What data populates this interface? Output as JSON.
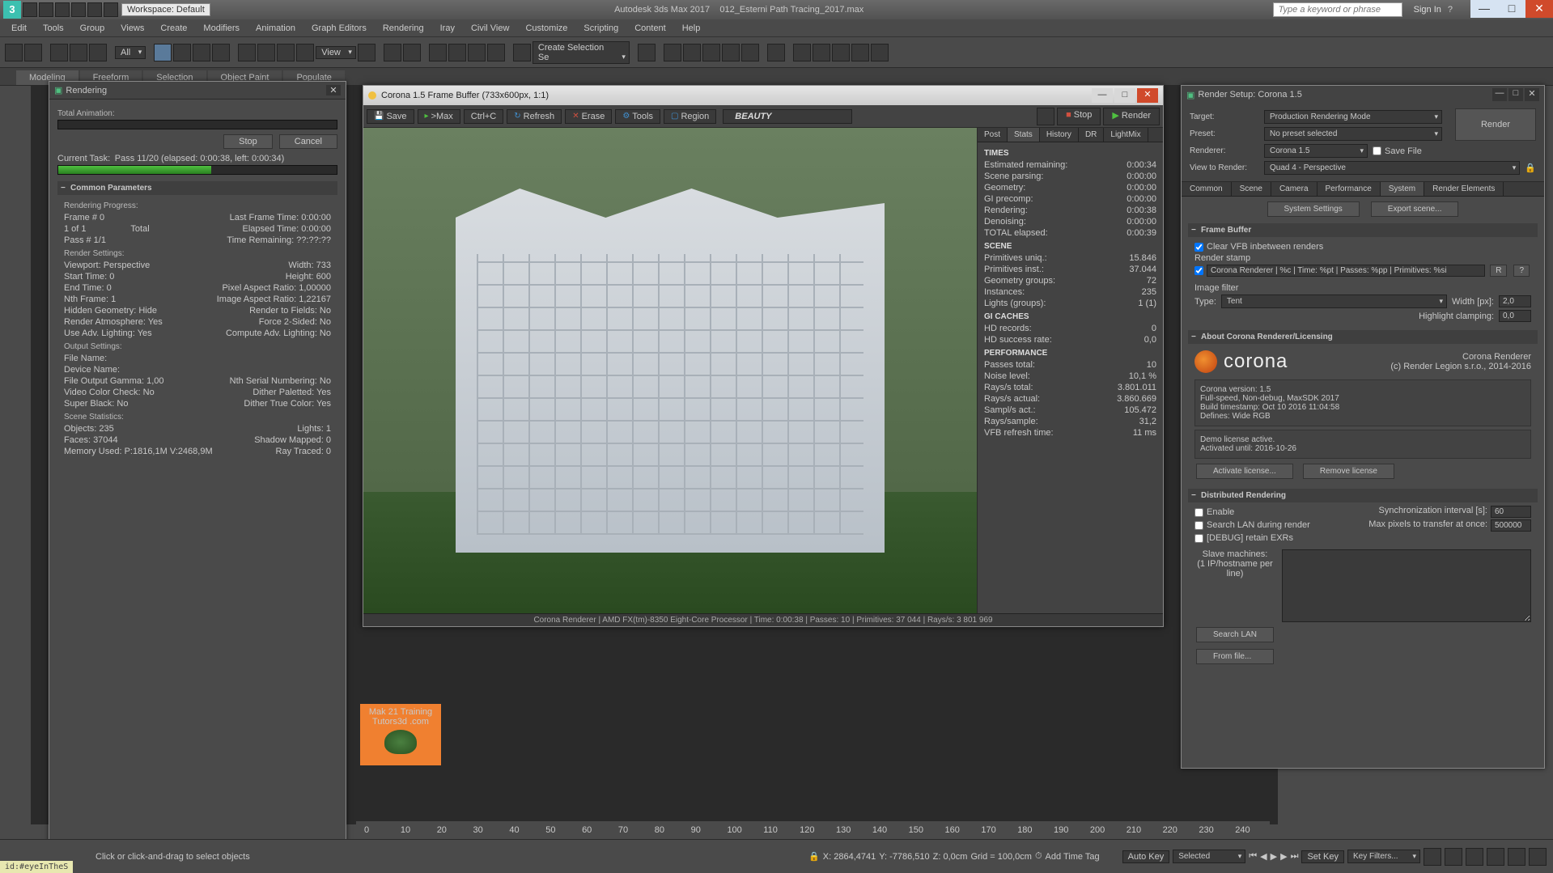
{
  "app": {
    "title": "Autodesk 3ds Max 2017",
    "file": "012_Esterni Path Tracing_2017.max",
    "workspace": "Workspace: Default",
    "search_placeholder": "Type a keyword or phrase",
    "signin": "Sign In"
  },
  "menu": [
    "Edit",
    "Tools",
    "Group",
    "Views",
    "Create",
    "Modifiers",
    "Animation",
    "Graph Editors",
    "Rendering",
    "Iray",
    "Civil View",
    "Customize",
    "Scripting",
    "Content",
    "Help"
  ],
  "ribbon": [
    "Modeling",
    "Freeform",
    "Selection",
    "Object Paint",
    "Populate"
  ],
  "toolbar": {
    "filter": "All",
    "view": "View",
    "selset": "Create Selection Se"
  },
  "rendering_panel": {
    "title": "Rendering",
    "total_anim": "Total Animation:",
    "stop": "Stop",
    "cancel": "Cancel",
    "current_task": "Current Task:",
    "current_task_val": "Pass 11/20 (elapsed: 0:00:38, left: 0:00:34)",
    "common_head": "Common Parameters",
    "progress_lbl": "Rendering Progress:",
    "frame": "Frame #  0",
    "total_lbl": "Total",
    "lastframe": "Last Frame Time:  0:00:00",
    "of": "1 of  1",
    "elapsed": "Elapsed Time:  0:00:00",
    "pass": "Pass #  1/1",
    "remain": "Time Remaining:  ??:??:??",
    "render_settings_lbl": "Render Settings:",
    "rs": [
      [
        "Viewport:  Perspective",
        "Width:  733"
      ],
      [
        "Start Time:  0",
        "Height:  600"
      ],
      [
        "End Time:  0",
        "Pixel Aspect Ratio:  1,00000"
      ],
      [
        "Nth Frame:  1",
        "Image Aspect Ratio:  1,22167"
      ],
      [
        "Hidden Geometry:  Hide",
        "Render to Fields:  No"
      ],
      [
        "Render Atmosphere:  Yes",
        "Force 2-Sided:  No"
      ],
      [
        "Use Adv. Lighting:  Yes",
        "Compute Adv. Lighting:  No"
      ]
    ],
    "output_lbl": "Output Settings:",
    "out": [
      [
        "File Name:",
        ""
      ],
      [
        "Device Name:",
        ""
      ],
      [
        "File Output Gamma:  1,00",
        "Nth Serial Numbering:  No"
      ],
      [
        "Video Color Check:  No",
        "Dither Paletted:  Yes"
      ],
      [
        "Super Black:  No",
        "Dither True Color:  Yes"
      ]
    ],
    "scene_lbl": "Scene Statistics:",
    "sc": [
      [
        "Objects:  235",
        "Lights:  1"
      ],
      [
        "Faces:  37044",
        "Shadow Mapped:  0"
      ],
      [
        "Memory Used:  P:1816,1M V:2468,9M",
        "Ray Traced:  0"
      ]
    ]
  },
  "framebuffer": {
    "title": "Corona 1.5 Frame Buffer (733x600px, 1:1)",
    "btns": {
      "save": "Save",
      "max": ">Max",
      "ctrlc": "Ctrl+C",
      "refresh": "Refresh",
      "erase": "Erase",
      "tools": "Tools",
      "region": "Region"
    },
    "pass": "BEAUTY",
    "stop": "Stop",
    "render": "Render",
    "tabs": [
      "Post",
      "Stats",
      "History",
      "DR",
      "LightMix"
    ],
    "times_head": "TIMES",
    "times": [
      [
        "Estimated remaining:",
        "0:00:34"
      ],
      [
        "Scene parsing:",
        "0:00:00"
      ],
      [
        "Geometry:",
        "0:00:00"
      ],
      [
        "GI precomp:",
        "0:00:00"
      ],
      [
        "Rendering:",
        "0:00:38"
      ],
      [
        "Denoising:",
        "0:00:00"
      ],
      [
        "TOTAL elapsed:",
        "0:00:39"
      ]
    ],
    "scene_head": "SCENE",
    "scene": [
      [
        "Primitives uniq.:",
        "15.846"
      ],
      [
        "Primitives inst.:",
        "37.044"
      ],
      [
        "Geometry groups:",
        "72"
      ],
      [
        "Instances:",
        "235"
      ],
      [
        "Lights (groups):",
        "1 (1)"
      ]
    ],
    "gi_head": "GI CACHES",
    "gi": [
      [
        "HD records:",
        "0"
      ],
      [
        "HD success rate:",
        "0,0"
      ]
    ],
    "perf_head": "PERFORMANCE",
    "perf": [
      [
        "Passes total:",
        "10"
      ],
      [
        "Noise level:",
        "10,1 %"
      ],
      [
        "Rays/s total:",
        "3.801.011"
      ],
      [
        "Rays/s actual:",
        "3.860.669"
      ],
      [
        "Sampl/s act.:",
        "105.472"
      ],
      [
        "Rays/sample:",
        "31,2"
      ],
      [
        "VFB refresh time:",
        "11 ms"
      ]
    ],
    "footer": "Corona Renderer | AMD FX(tm)-8350 Eight-Core Processor  | Time: 0:00:38 | Passes: 10 | Primitives: 37 044 | Rays/s: 3 801 969"
  },
  "render_setup": {
    "title": "Render Setup: Corona 1.5",
    "target_lbl": "Target:",
    "target": "Production Rendering Mode",
    "preset_lbl": "Preset:",
    "preset": "No preset selected",
    "renderer_lbl": "Renderer:",
    "renderer": "Corona 1.5",
    "savefile": "Save File",
    "view_lbl": "View to Render:",
    "view": "Quad 4 - Perspective",
    "render_btn": "Render",
    "tabs": [
      "Common",
      "Scene",
      "Camera",
      "Performance",
      "System",
      "Render Elements"
    ],
    "sys_settings": "System Settings",
    "export": "Export scene...",
    "fb_head": "Frame Buffer",
    "fb_clear": "Clear VFB inbetween renders",
    "fb_corona": "Corona Renderer",
    "render_stamp": "Render stamp",
    "stamp_val": "Corona Renderer | %c | Time: %pt | Passes: %pp | Primitives: %si",
    "imgfilter": "Image filter",
    "type_lbl": "Type:",
    "filter_type": "Tent",
    "width_lbl": "Width [px]:",
    "width": "2,0",
    "clamp_lbl": "Highlight clamping:",
    "clamp": "0,0",
    "about_head": "About Corona Renderer/Licensing",
    "corona_name": "corona",
    "corona_sub": "Corona Renderer",
    "copyright": "(c) Render Legion s.r.o., 2014-2016",
    "info": "Corona version: 1.5\nFull-speed, Non-debug, MaxSDK 2017\nBuild timestamp: Oct 10 2016 11:04:58\nDefines: Wide RGB",
    "license": "Demo license active.\nActivated until: 2016-10-26",
    "activate": "Activate license...",
    "remove": "Remove license",
    "dist_head": "Distributed Rendering",
    "enable": "Enable",
    "search_lan_r": "Search LAN during render",
    "debug": "[DEBUG] retain EXRs",
    "sync_lbl": "Synchronization interval [s]:",
    "sync": "60",
    "maxpx_lbl": "Max pixels to transfer at once:",
    "maxpx": "500000",
    "slaves": "Slave machines:\n(1 IP/hostname per line)",
    "search_lan": "Search LAN",
    "from_file": "From file..."
  },
  "status": {
    "hint": "Click or click-and-drag to select objects",
    "x": "X: 2864,4741",
    "y": "Y: -7786,510",
    "z": "Z: 0,0cm",
    "grid": "Grid = 100,0cm",
    "addtag": "Add Time Tag",
    "autokey": "Auto Key",
    "selected": "Selected",
    "setkey": "Set Key",
    "keyfilters": "Key Filters...",
    "maxscript": "id:#eyeInTheS"
  },
  "timeline": [
    "0",
    "10",
    "20",
    "30",
    "40",
    "50",
    "60",
    "70",
    "80",
    "90",
    "100",
    "110",
    "120",
    "130",
    "140",
    "150",
    "160",
    "170",
    "180",
    "190",
    "200",
    "210",
    "220",
    "230",
    "240"
  ],
  "watermark": {
    "l1": "Mak 21 Training",
    "l2": "Tutors3d .com"
  }
}
